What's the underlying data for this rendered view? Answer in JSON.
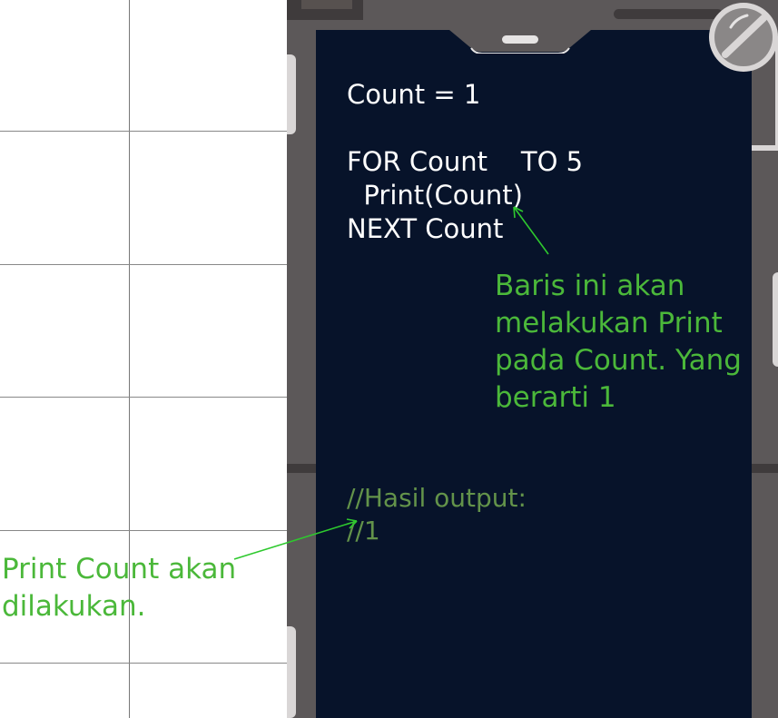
{
  "code": {
    "line1": "Count = 1",
    "line2": "FOR Count    TO 5",
    "line3": "  Print(Count)",
    "line4": "NEXT Count"
  },
  "annotation_right": {
    "line1": "Baris ini akan",
    "line2": "melakukan Print",
    "line3": "pada Count. Yang",
    "line4": "berarti 1"
  },
  "output": {
    "line1": "//Hasil output:",
    "line2": "//1"
  },
  "annotation_left": {
    "line1": "Print Count akan",
    "line2": "dilakukan."
  },
  "colors": {
    "annotation": "#4bb83a",
    "comment": "#63934a",
    "screen": "#07132a",
    "stage": "#5c5859"
  },
  "icons": {
    "top_right": "disabled-circle-icon"
  }
}
